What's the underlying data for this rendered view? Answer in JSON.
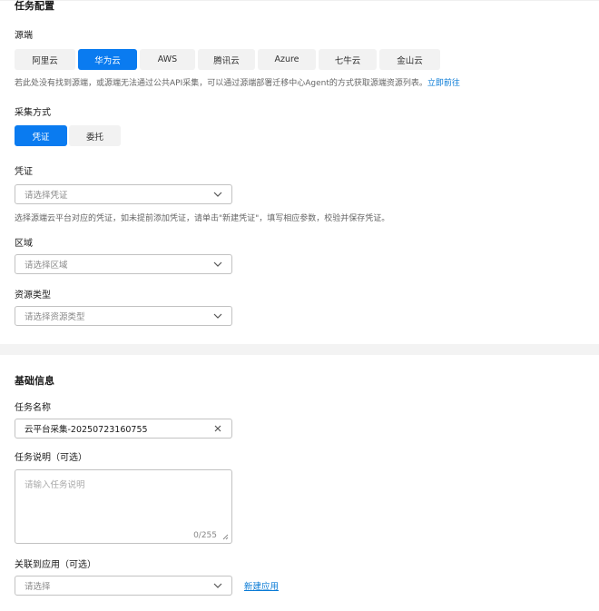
{
  "task_config": {
    "title": "任务配置",
    "source_label": "源端",
    "source_options": [
      "阿里云",
      "华为云",
      "AWS",
      "腾讯云",
      "Azure",
      "七牛云",
      "金山云"
    ],
    "source_selected": "华为云",
    "source_hint": "若此处没有找到源端，或源端无法通过公共API采集，可以通过源端部署迁移中心Agent的方式获取源端资源列表。",
    "source_hint_link": "立即前往",
    "method_label": "采集方式",
    "method_options": [
      "凭证",
      "委托"
    ],
    "method_selected": "凭证",
    "credential_label": "凭证",
    "credential_placeholder": "请选择凭证",
    "credential_hint": "选择源端云平台对应的凭证，如未提前添加凭证，请单击\"新建凭证\"，填写相应参数，校验并保存凭证。",
    "region_label": "区域",
    "region_placeholder": "请选择区域",
    "resource_type_label": "资源类型",
    "resource_type_placeholder": "请选择资源类型"
  },
  "basic_info": {
    "title": "基础信息",
    "task_name_label": "任务名称",
    "task_name_value": "云平台采集-20250723160755",
    "task_desc_label": "任务说明（可选）",
    "task_desc_placeholder": "请输入任务说明",
    "task_desc_count": "0/255",
    "app_label": "关联到应用（可选）",
    "app_placeholder": "请选择",
    "new_app_link": "新建应用"
  },
  "icons": {
    "dropdown": "chevron-down-icon",
    "clear": "close-icon",
    "resize": "resize-grip-icon"
  },
  "colors": {
    "accent": "#0a7bf0",
    "link": "#0a7bd6"
  }
}
